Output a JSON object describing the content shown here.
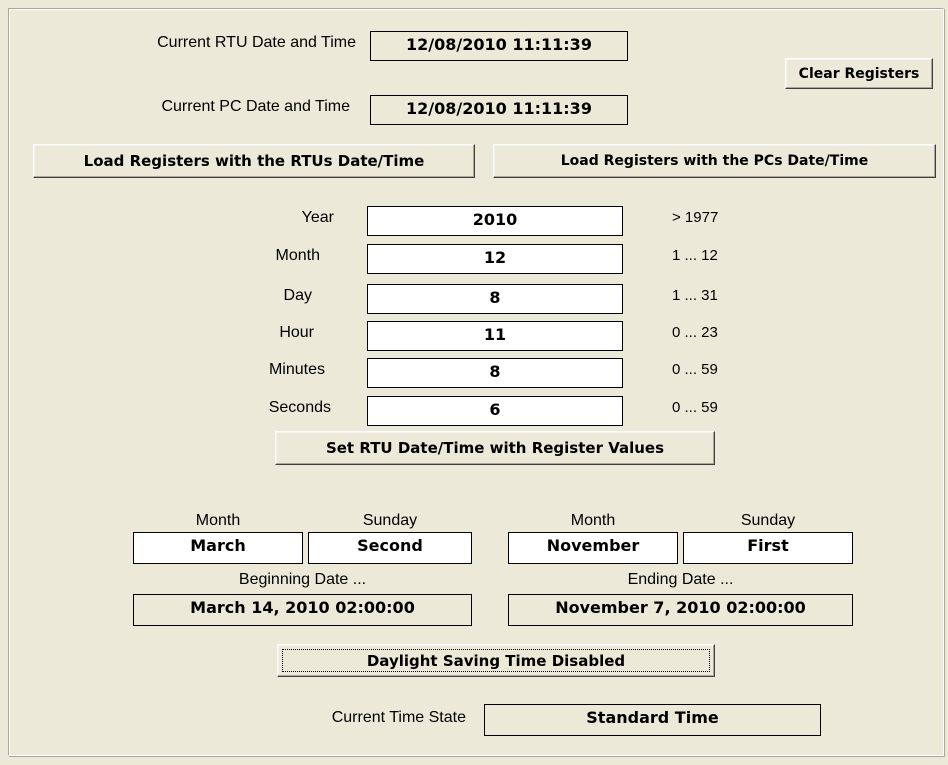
{
  "rtu_time": {
    "label": "Current RTU Date and Time",
    "value": "12/08/2010 11:11:39"
  },
  "pc_time": {
    "label": "Current PC Date and Time",
    "value": "12/08/2010 11:11:39"
  },
  "buttons": {
    "clear_registers": "Clear Registers",
    "load_rtu": "Load Registers with the RTUs Date/Time",
    "load_pc": "Load Registers with the PCs Date/Time",
    "set_rtu": "Set RTU Date/Time with Register Values",
    "dst": "Daylight Saving Time Disabled"
  },
  "registers": [
    {
      "label": "Year",
      "value": "2010",
      "range": "> 1977"
    },
    {
      "label": "Month",
      "value": "12",
      "range": "1 ... 12"
    },
    {
      "label": "Day",
      "value": "8",
      "range": "1 ... 31"
    },
    {
      "label": "Hour",
      "value": "11",
      "range": "0 ... 23"
    },
    {
      "label": "Minutes",
      "value": "8",
      "range": "0 ... 59"
    },
    {
      "label": "Seconds",
      "value": "6",
      "range": "0 ... 59"
    }
  ],
  "dst_begin": {
    "month_label": "Month",
    "month_value": "March",
    "sunday_label": "Sunday",
    "sunday_value": "Second",
    "date_label": "Beginning Date ...",
    "date_value": "March 14, 2010 02:00:00"
  },
  "dst_end": {
    "month_label": "Month",
    "month_value": "November",
    "sunday_label": "Sunday",
    "sunday_value": "First",
    "date_label": "Ending Date ...",
    "date_value": "November 7, 2010 02:00:00"
  },
  "time_state": {
    "label": "Current Time State",
    "value": "Standard Time"
  },
  "colors": {
    "background": "#ece9d8",
    "field_white": "#ffffff",
    "border": "#000000"
  }
}
